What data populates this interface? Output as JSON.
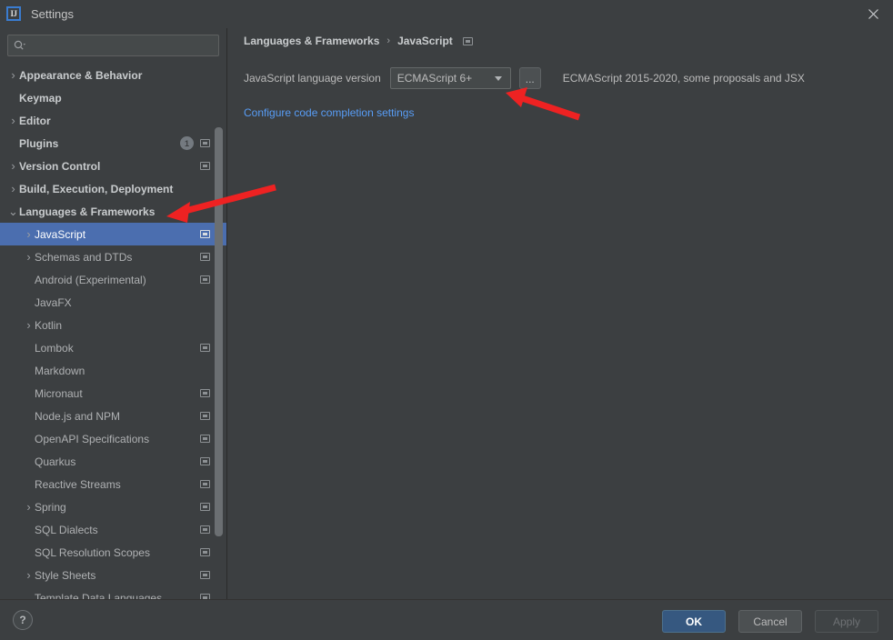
{
  "window": {
    "title": "Settings",
    "logo_text": "IJ",
    "close_icon": "close-icon"
  },
  "sidebar": {
    "search": {
      "placeholder": "",
      "value": "",
      "icon": "search-icon"
    },
    "items": [
      {
        "label": "Appearance & Behavior",
        "level": 0,
        "expandable": true,
        "expanded": false,
        "top": true,
        "selected": false,
        "project_icon": false,
        "badge": ""
      },
      {
        "label": "Keymap",
        "level": 0,
        "expandable": false,
        "expanded": false,
        "top": true,
        "selected": false,
        "project_icon": false,
        "badge": ""
      },
      {
        "label": "Editor",
        "level": 0,
        "expandable": true,
        "expanded": false,
        "top": true,
        "selected": false,
        "project_icon": false,
        "badge": ""
      },
      {
        "label": "Plugins",
        "level": 0,
        "expandable": false,
        "expanded": false,
        "top": true,
        "selected": false,
        "project_icon": true,
        "badge": "1"
      },
      {
        "label": "Version Control",
        "level": 0,
        "expandable": true,
        "expanded": false,
        "top": true,
        "selected": false,
        "project_icon": true,
        "badge": ""
      },
      {
        "label": "Build, Execution, Deployment",
        "level": 0,
        "expandable": true,
        "expanded": false,
        "top": true,
        "selected": false,
        "project_icon": false,
        "badge": ""
      },
      {
        "label": "Languages & Frameworks",
        "level": 0,
        "expandable": true,
        "expanded": true,
        "top": true,
        "selected": false,
        "project_icon": false,
        "badge": ""
      },
      {
        "label": "JavaScript",
        "level": 1,
        "expandable": true,
        "expanded": false,
        "top": false,
        "selected": true,
        "project_icon": true,
        "badge": ""
      },
      {
        "label": "Schemas and DTDs",
        "level": 1,
        "expandable": true,
        "expanded": false,
        "top": false,
        "selected": false,
        "project_icon": true,
        "badge": ""
      },
      {
        "label": "Android (Experimental)",
        "level": 1,
        "expandable": false,
        "expanded": false,
        "top": false,
        "selected": false,
        "project_icon": true,
        "badge": ""
      },
      {
        "label": "JavaFX",
        "level": 1,
        "expandable": false,
        "expanded": false,
        "top": false,
        "selected": false,
        "project_icon": false,
        "badge": ""
      },
      {
        "label": "Kotlin",
        "level": 1,
        "expandable": true,
        "expanded": false,
        "top": false,
        "selected": false,
        "project_icon": false,
        "badge": ""
      },
      {
        "label": "Lombok",
        "level": 1,
        "expandable": false,
        "expanded": false,
        "top": false,
        "selected": false,
        "project_icon": true,
        "badge": ""
      },
      {
        "label": "Markdown",
        "level": 1,
        "expandable": false,
        "expanded": false,
        "top": false,
        "selected": false,
        "project_icon": false,
        "badge": ""
      },
      {
        "label": "Micronaut",
        "level": 1,
        "expandable": false,
        "expanded": false,
        "top": false,
        "selected": false,
        "project_icon": true,
        "badge": ""
      },
      {
        "label": "Node.js and NPM",
        "level": 1,
        "expandable": false,
        "expanded": false,
        "top": false,
        "selected": false,
        "project_icon": true,
        "badge": ""
      },
      {
        "label": "OpenAPI Specifications",
        "level": 1,
        "expandable": false,
        "expanded": false,
        "top": false,
        "selected": false,
        "project_icon": true,
        "badge": ""
      },
      {
        "label": "Quarkus",
        "level": 1,
        "expandable": false,
        "expanded": false,
        "top": false,
        "selected": false,
        "project_icon": true,
        "badge": ""
      },
      {
        "label": "Reactive Streams",
        "level": 1,
        "expandable": false,
        "expanded": false,
        "top": false,
        "selected": false,
        "project_icon": true,
        "badge": ""
      },
      {
        "label": "Spring",
        "level": 1,
        "expandable": true,
        "expanded": false,
        "top": false,
        "selected": false,
        "project_icon": true,
        "badge": ""
      },
      {
        "label": "SQL Dialects",
        "level": 1,
        "expandable": false,
        "expanded": false,
        "top": false,
        "selected": false,
        "project_icon": true,
        "badge": ""
      },
      {
        "label": "SQL Resolution Scopes",
        "level": 1,
        "expandable": false,
        "expanded": false,
        "top": false,
        "selected": false,
        "project_icon": true,
        "badge": ""
      },
      {
        "label": "Style Sheets",
        "level": 1,
        "expandable": true,
        "expanded": false,
        "top": false,
        "selected": false,
        "project_icon": true,
        "badge": ""
      },
      {
        "label": "Template Data Languages",
        "level": 1,
        "expandable": false,
        "expanded": false,
        "top": false,
        "selected": false,
        "project_icon": true,
        "badge": ""
      }
    ]
  },
  "main": {
    "breadcrumb": {
      "parent": "Languages & Frameworks",
      "separator": "›",
      "current": "JavaScript",
      "icon": "project-scope-icon"
    },
    "language_version": {
      "label": "JavaScript language version",
      "value": "ECMAScript 6+",
      "ellipsis_label": "...",
      "hint": "ECMAScript 2015-2020, some proposals and JSX"
    },
    "config_link": "Configure code completion settings"
  },
  "footer": {
    "help_label": "?",
    "ok_label": "OK",
    "cancel_label": "Cancel",
    "apply_label": "Apply"
  },
  "colors": {
    "background": "#3c3f41",
    "selection": "#4b6eaf",
    "link": "#589df6",
    "primary_button": "#365880",
    "annotation_arrow": "#ee2222"
  }
}
